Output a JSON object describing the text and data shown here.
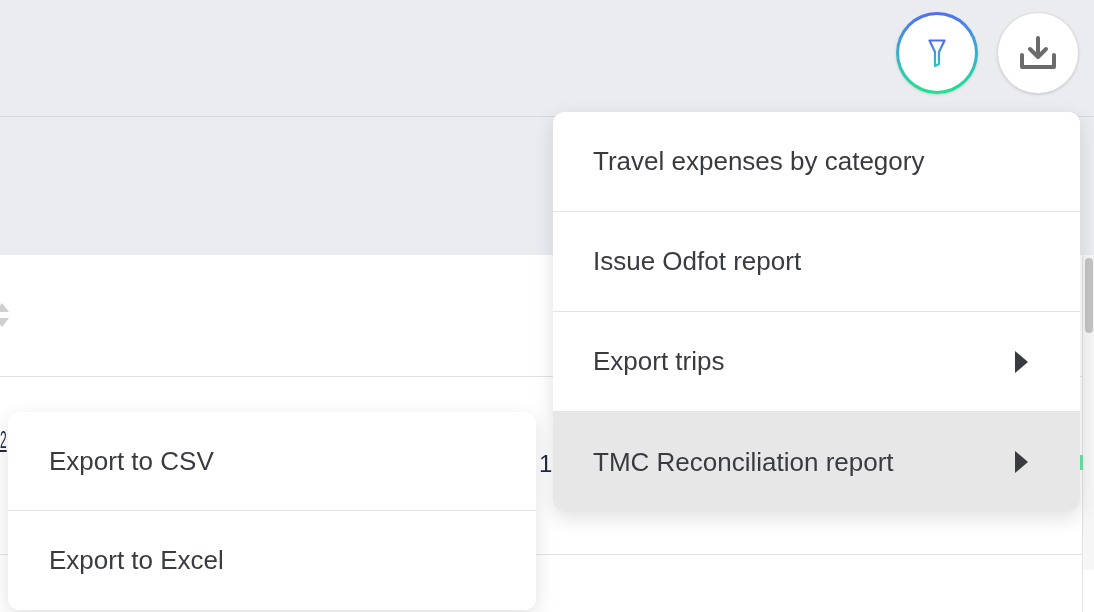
{
  "toolbar": {
    "buttons": [
      {
        "kind": "filter",
        "active": true
      },
      {
        "kind": "download",
        "active": false
      }
    ]
  },
  "table": {
    "columns": [
      {
        "sortable": true
      }
    ],
    "rows": [
      {
        "cells": [
          {
            "kind": "link",
            "text": "2"
          },
          {
            "kind": "text",
            "text": "1"
          }
        ]
      }
    ]
  },
  "menu": {
    "items": [
      {
        "label": "Travel expenses by category",
        "has_submenu": false,
        "selected": false
      },
      {
        "label": "Issue Odfot report",
        "has_submenu": false,
        "selected": false
      },
      {
        "label": "Export trips",
        "has_submenu": true,
        "selected": false
      },
      {
        "label": "TMC Reconciliation report",
        "has_submenu": true,
        "selected": true
      }
    ]
  },
  "submenu": {
    "items": [
      {
        "label": "Export to CSV",
        "selected": false
      },
      {
        "label": "Export to Excel",
        "selected": false
      }
    ]
  }
}
